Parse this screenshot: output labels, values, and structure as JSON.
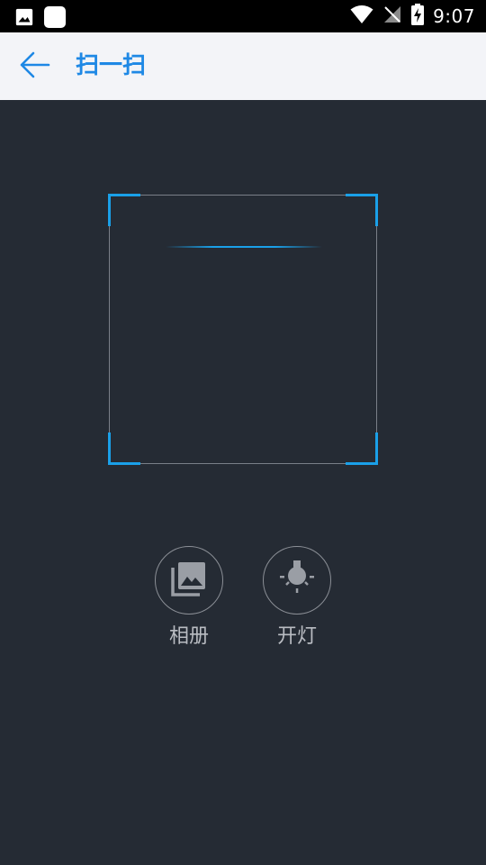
{
  "status_bar": {
    "time": "9:07",
    "left_icons": [
      "image-icon",
      "app-square-icon"
    ],
    "right_icons": [
      "wifi-icon",
      "no-signal-icon",
      "battery-charging-icon"
    ]
  },
  "app_bar": {
    "back_icon": "arrow-left-icon",
    "title": "扫一扫"
  },
  "scanner": {
    "frame_color": "#1aa0e8"
  },
  "actions": {
    "album": {
      "icon": "photo-library-icon",
      "label": "相册"
    },
    "light": {
      "icon": "bulb-icon",
      "label": "开灯"
    }
  },
  "colors": {
    "background": "#252b34",
    "accent": "#1e88e5",
    "app_bar_bg": "#f3f4f8",
    "status_bar_bg": "#000000"
  }
}
